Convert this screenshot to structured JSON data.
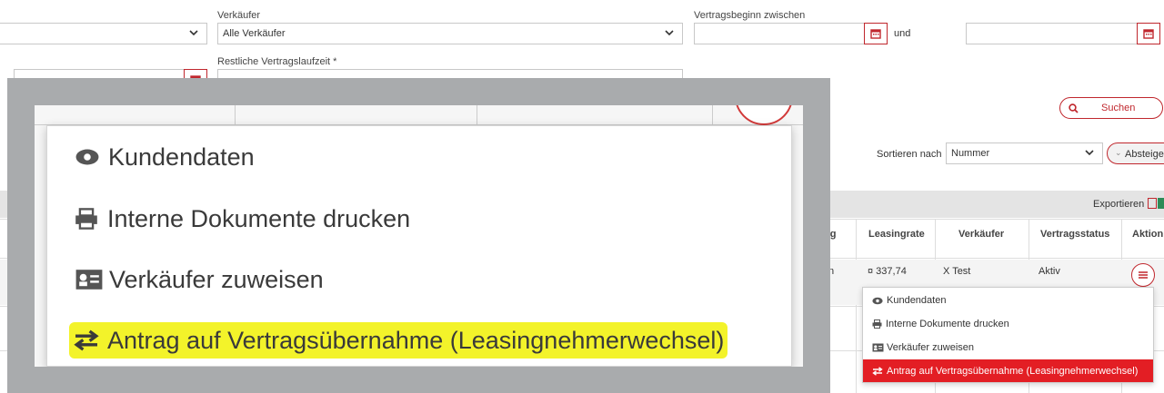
{
  "filters": {
    "verkaeufer_label": "Verkäufer",
    "verkaeufer_value": "Alle Verkäufer",
    "vertragsbeginn_label": "Vertragsbeginn zwischen",
    "und": "und",
    "restliche_label": "Restliche Vertragslaufzeit *",
    "search_label": "Suchen"
  },
  "sort": {
    "label": "Sortieren nach",
    "value": "Nummer",
    "order_label": "Absteige"
  },
  "export_label": "Exportieren",
  "table": {
    "headers": [
      "Leasingrate",
      "Verkäufer",
      "Vertragsstatus",
      "Aktion"
    ],
    "partial_header": "ng",
    "row": {
      "leasingrate": "¤ 337,74",
      "verkaeufer": "X Test",
      "status": "Aktiv",
      "partial": "n"
    }
  },
  "menu": {
    "items": [
      {
        "label": "Kundendaten",
        "icon": "eye-icon"
      },
      {
        "label": "Interne Dokumente drucken",
        "icon": "printer-icon"
      },
      {
        "label": "Verkäufer zuweisen",
        "icon": "id-card-icon"
      },
      {
        "label": "Antrag auf Vertragsübernahme (Leasingnehmerwechsel)",
        "icon": "swap-arrows-icon"
      }
    ]
  },
  "zoom_menu": {
    "items": [
      {
        "label": "Kundendaten",
        "icon": "eye-icon"
      },
      {
        "label": "Interne Dokumente drucken",
        "icon": "printer-icon"
      },
      {
        "label": "Verkäufer zuweisen",
        "icon": "id-card-icon"
      },
      {
        "label": "Antrag auf Vertragsübernahme (Leasingnehmerwechsel)",
        "icon": "swap-arrows-icon"
      }
    ]
  },
  "colors": {
    "accent": "#c0272d",
    "highlight": "#f3f32a",
    "overlay": "#a9abad",
    "active_row": "#e31e24"
  }
}
